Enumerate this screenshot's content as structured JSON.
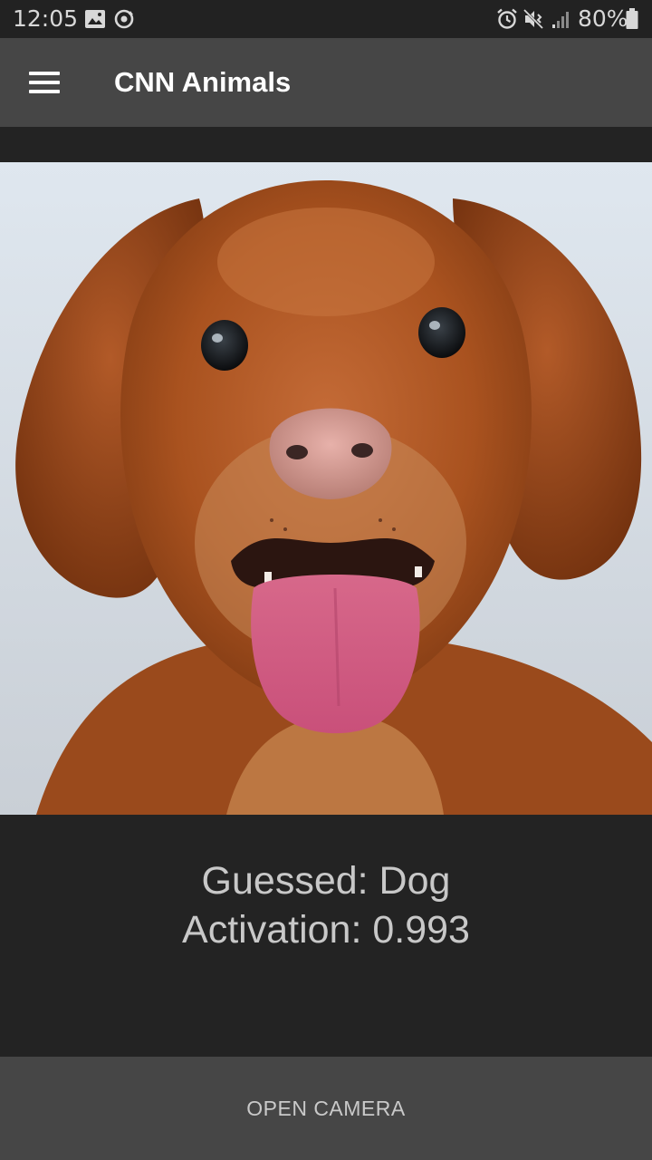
{
  "status_bar": {
    "time": "12:05",
    "battery_percent": "80%",
    "icons": [
      "image-icon",
      "sync-icon",
      "alarm-icon",
      "mute-vibrate-icon",
      "signal-icon",
      "battery-icon"
    ]
  },
  "app_bar": {
    "title": "CNN Animals",
    "menu_icon": "hamburger-menu-icon",
    "background": "#464646"
  },
  "photo": {
    "subject": "dog photo"
  },
  "result": {
    "guessed": "Guessed: Dog",
    "activation": "Activation: 0.993"
  },
  "actions": {
    "open_camera_label": "OPEN CAMERA"
  },
  "colors": {
    "background": "#232323",
    "status_bar": "#222222",
    "text_primary": "#ffffff",
    "text_secondary": "#c8c8c8"
  }
}
